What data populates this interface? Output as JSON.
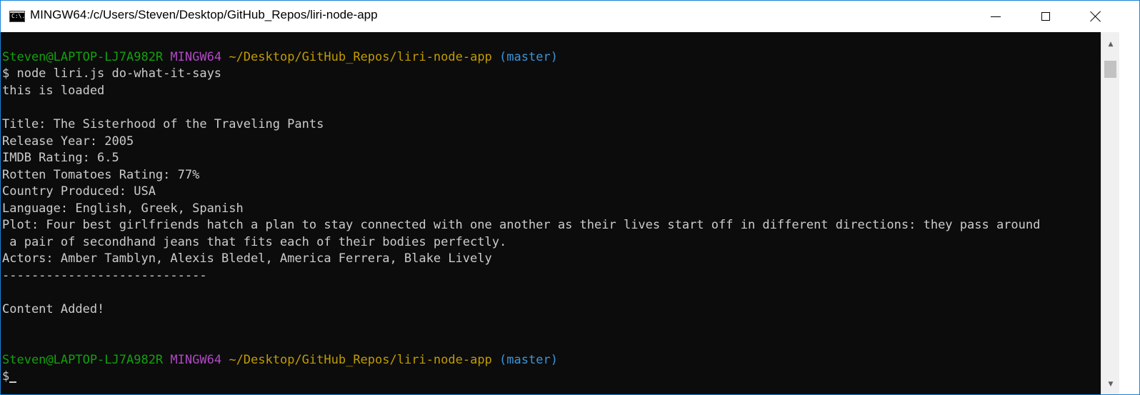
{
  "window": {
    "title": "MINGW64:/c/Users/Steven/Desktop/GitHub_Repos/liri-node-app",
    "icon": "console-icon",
    "icon_text": "C:\\."
  },
  "colors": {
    "prompt_user": "#13a10e",
    "prompt_env": "#b148c6",
    "prompt_path": "#c19c00",
    "prompt_branch": "#3a96dd",
    "text": "#cccccc",
    "background": "#0c0c0c"
  },
  "terminal": {
    "prompt1": {
      "user": "Steven@LAPTOP-LJ7A982R",
      "env": "MINGW64",
      "path": "~/Desktop/GitHub_Repos/liri-node-app",
      "branch": "(master)"
    },
    "command": "$ node liri.js do-what-it-says",
    "output": {
      "loaded": "this is loaded",
      "title": "Title: The Sisterhood of the Traveling Pants",
      "release_year": "Release Year: 2005",
      "imdb": "IMDB Rating: 6.5",
      "rotten": "Rotten Tomatoes Rating: 77%",
      "country": "Country Produced: USA",
      "language": "Language: English, Greek, Spanish",
      "plot_line1": "Plot: Four best girlfriends hatch a plan to stay connected with one another as their lives start off in different directions: they pass around",
      "plot_line2": " a pair of secondhand jeans that fits each of their bodies perfectly.",
      "actors": "Actors: Amber Tamblyn, Alexis Bledel, America Ferrera, Blake Lively",
      "divider": "----------------------------",
      "content_added": "Content Added!"
    },
    "prompt2": {
      "user": "Steven@LAPTOP-LJ7A982R",
      "env": "MINGW64",
      "path": "~/Desktop/GitHub_Repos/liri-node-app",
      "branch": "(master)"
    },
    "input_prompt": "$"
  }
}
